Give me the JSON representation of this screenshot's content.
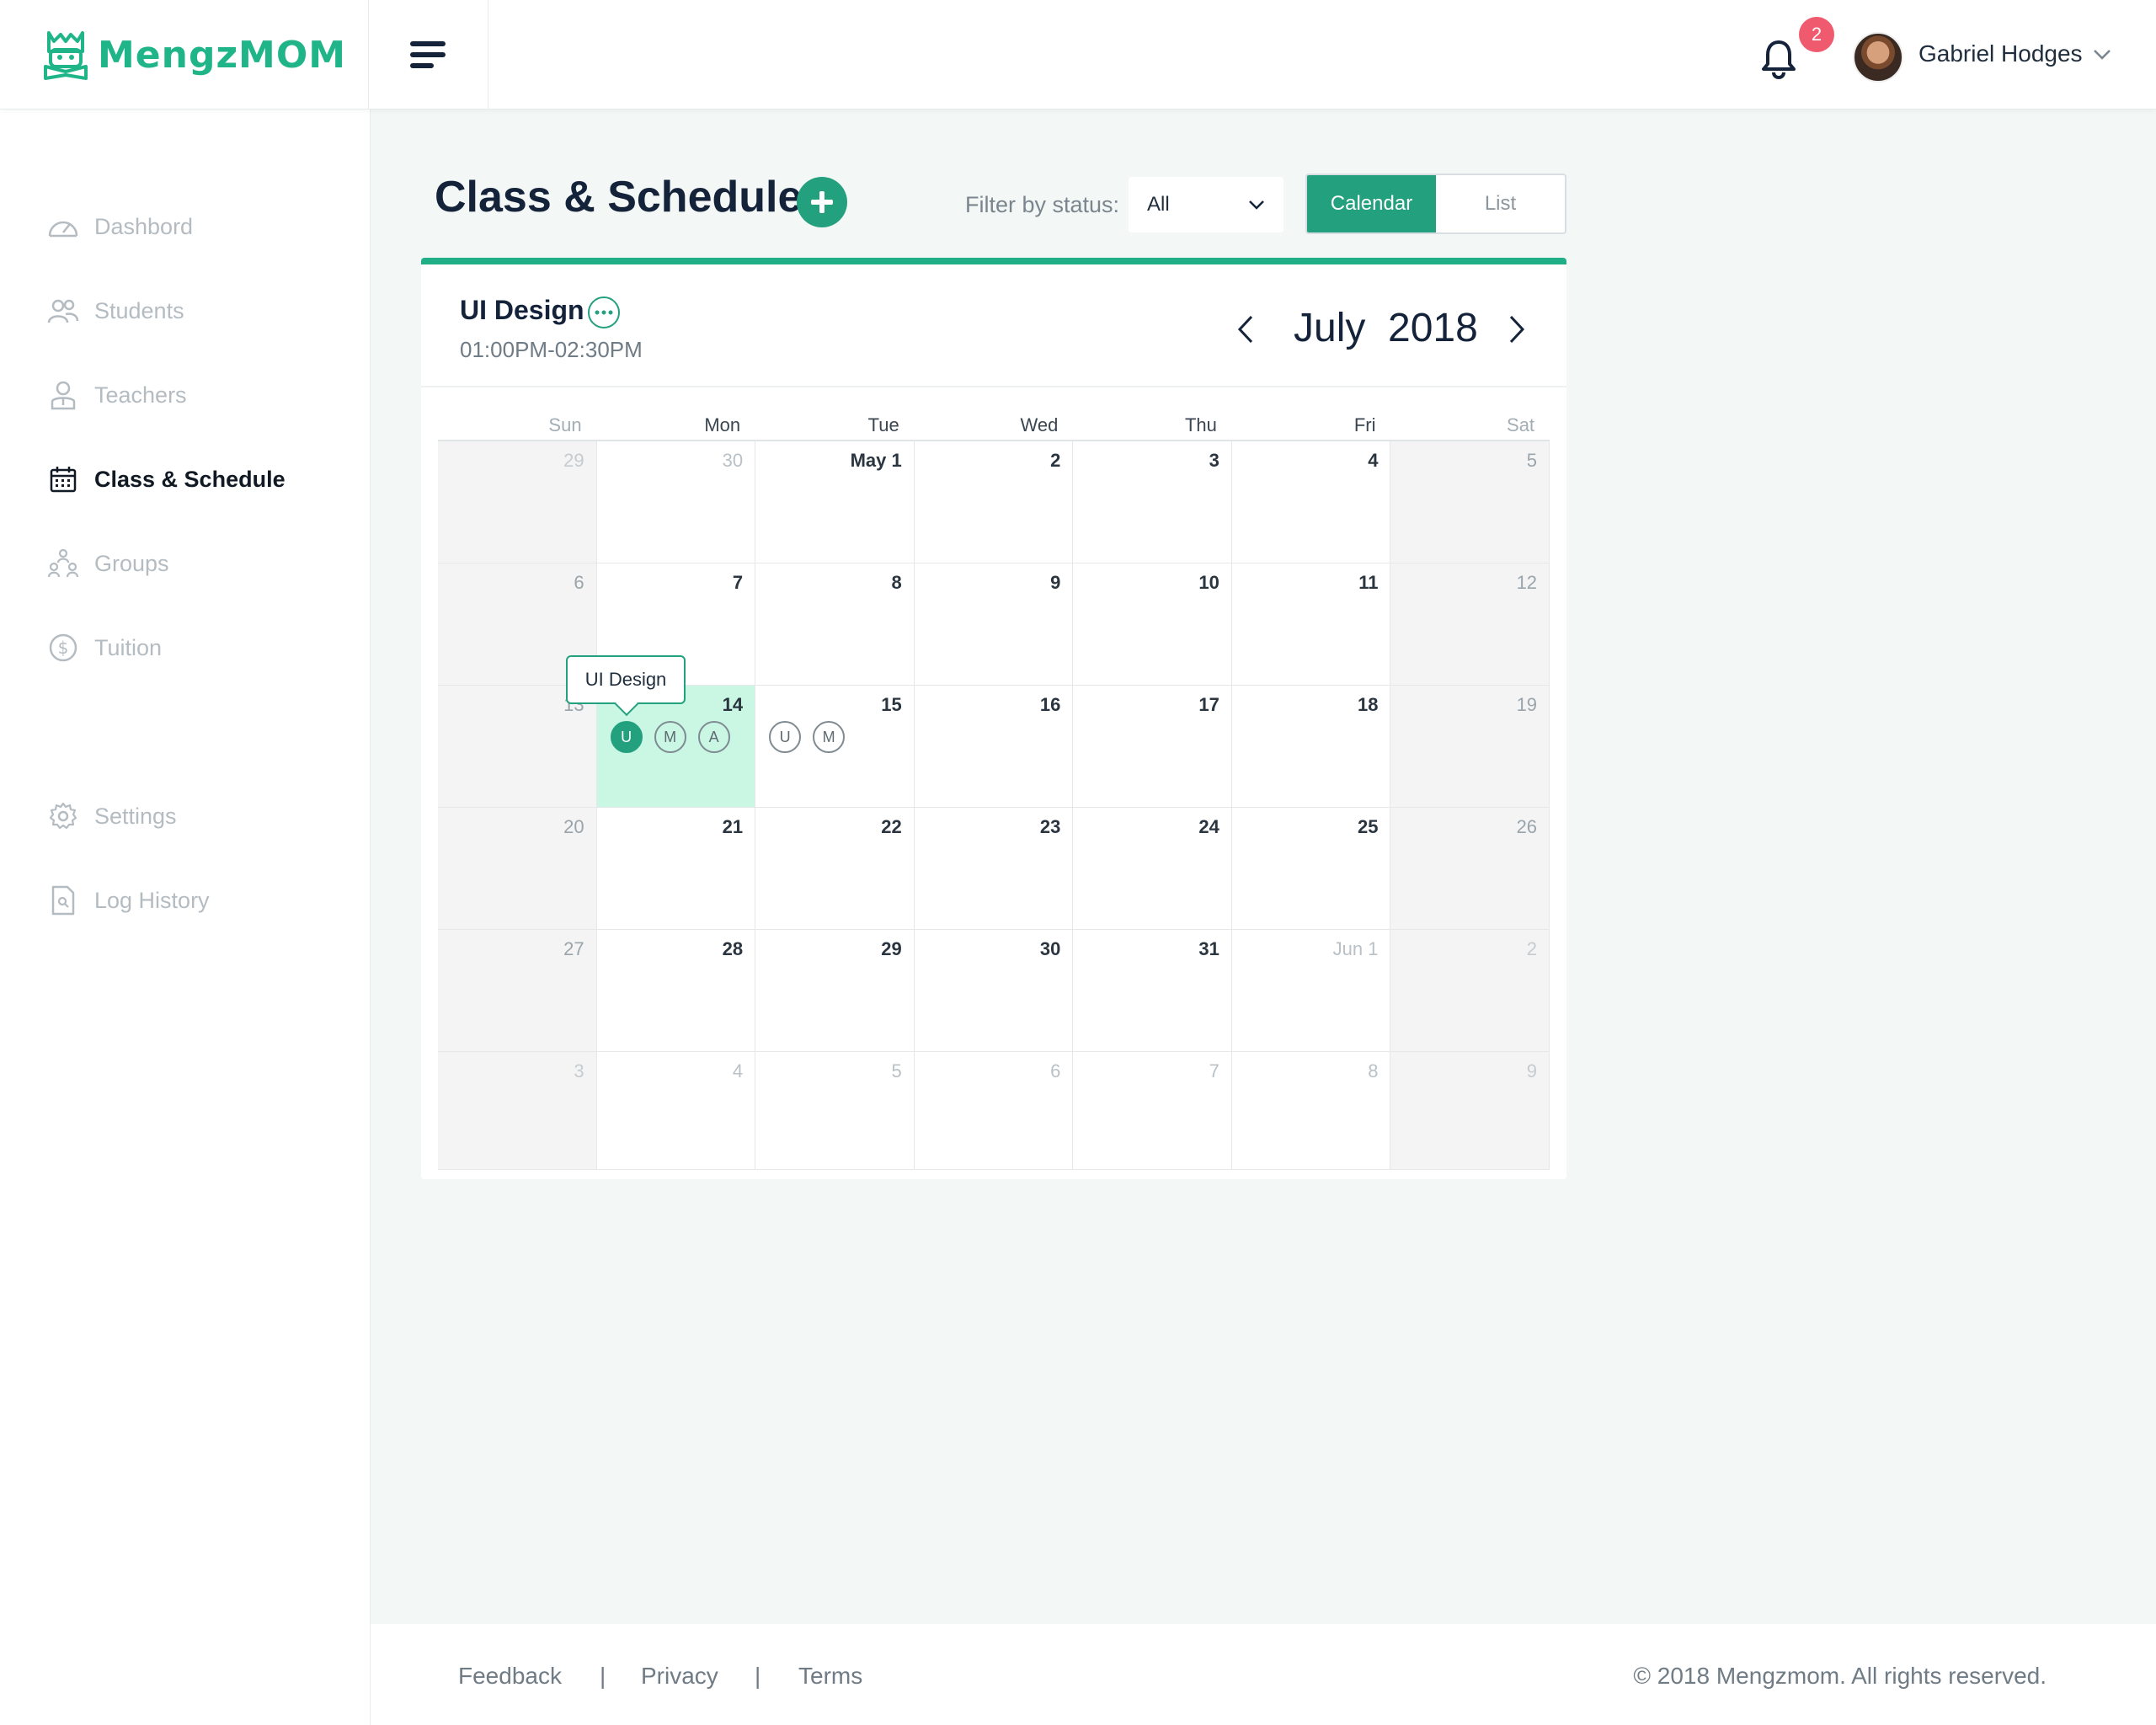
{
  "brand": {
    "name": "MengzMOM",
    "color": "#1fb589"
  },
  "header": {
    "notifications_count": "2",
    "user_name": "Gabriel Hodges"
  },
  "sidebar": {
    "items": [
      {
        "label": "Dashbord",
        "icon": "dashboard-icon",
        "active": false
      },
      {
        "label": "Students",
        "icon": "students-icon",
        "active": false
      },
      {
        "label": "Teachers",
        "icon": "teacher-icon",
        "active": false
      },
      {
        "label": "Class & Schedule",
        "icon": "calendar-icon",
        "active": true
      },
      {
        "label": "Groups",
        "icon": "groups-icon",
        "active": false
      },
      {
        "label": "Tuition",
        "icon": "dollar-icon",
        "active": false
      },
      {
        "label": "Settings",
        "icon": "gear-icon",
        "active": false
      },
      {
        "label": "Log History",
        "icon": "log-icon",
        "active": false
      }
    ]
  },
  "main": {
    "title": "Class & Schedule",
    "filter_label": "Filter by status:",
    "filter_value": "All",
    "view_options": [
      "Calendar",
      "List"
    ],
    "selected_view": "Calendar",
    "accent": "#23a07e"
  },
  "calendar": {
    "event_name": "UI Design",
    "event_time": "01:00PM-02:30PM",
    "month_label": "July  2018",
    "weekdays": [
      "Sun",
      "Mon",
      "Tue",
      "Wed",
      "Thu",
      "Fri",
      "Sat"
    ],
    "weeks": [
      [
        "29",
        "30",
        "May 1",
        "2",
        "3",
        "4",
        "5"
      ],
      [
        "6",
        "7",
        "8",
        "9",
        "10",
        "11",
        "12"
      ],
      [
        "13",
        "14",
        "15",
        "16",
        "17",
        "18",
        "19"
      ],
      [
        "20",
        "21",
        "22",
        "23",
        "24",
        "25",
        "26"
      ],
      [
        "27",
        "28",
        "29",
        "30",
        "31",
        "Jun 1",
        "2"
      ],
      [
        "3",
        "4",
        "5",
        "6",
        "7",
        "8",
        "9"
      ]
    ],
    "tooltip": "UI Design",
    "day14_chips": [
      "U",
      "M",
      "A"
    ],
    "day15_chips": [
      "U",
      "M"
    ]
  },
  "footer": {
    "links": [
      "Feedback",
      "Privacy",
      "Terms"
    ],
    "separator": "|",
    "copyright": "© 2018 Mengzmom. All rights reserved."
  }
}
